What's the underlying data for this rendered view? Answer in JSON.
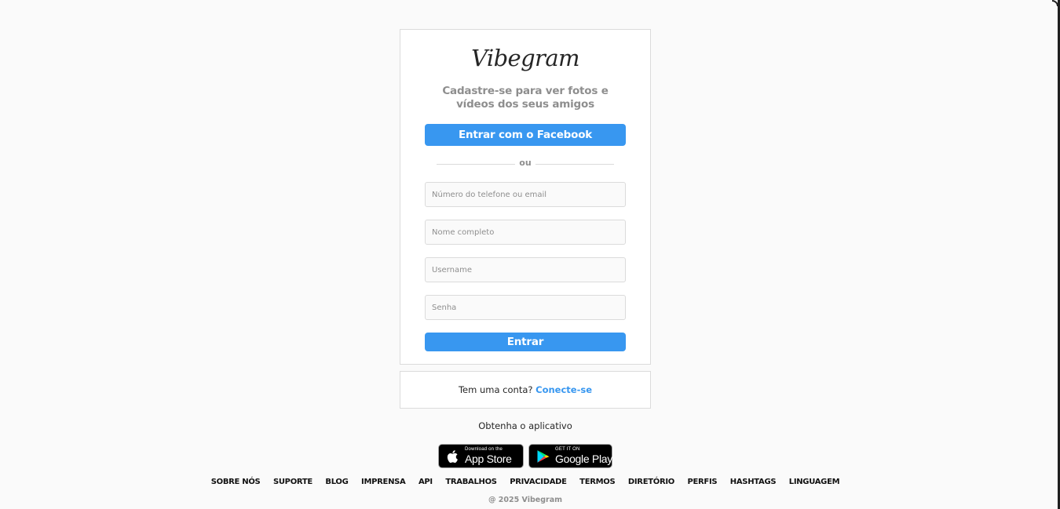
{
  "brand": {
    "logo_text": "Vibegram"
  },
  "signup": {
    "tagline_line1": "Cadastre-se para ver fotos e",
    "tagline_line2": "vídeos dos seus amigos",
    "facebook_button": "Entrar com o Facebook",
    "divider_text": "ou",
    "fields": {
      "contact_placeholder": "Número do telefone ou email",
      "fullname_placeholder": "Nome completo",
      "username_placeholder": "Username",
      "password_placeholder": "Senha"
    },
    "submit_button": "Entrar"
  },
  "login_prompt": {
    "text": "Tem uma conta?",
    "link": "Conecte-se"
  },
  "get_app": {
    "label": "Obtenha o aplicativo",
    "app_store_small": "Download on the",
    "app_store_big": "App Store",
    "google_play_small": "GET IT ON",
    "google_play_big": "Google Play"
  },
  "footer": {
    "links": [
      "SOBRE NÓS",
      "SUPORTE",
      "BLOG",
      "IMPRENSA",
      "API",
      "TRABALHOS",
      "PRIVACIDADE",
      "TERMOS",
      "DIRETÓRIO",
      "PERFIS",
      "HASHTAGS",
      "LINGUAGEM"
    ],
    "copyright": "@ 2025 Vibegram"
  },
  "colors": {
    "accent": "#3897f0",
    "background": "#fafafa",
    "border": "#dbdbdb",
    "muted_text": "#8e8e8e"
  }
}
